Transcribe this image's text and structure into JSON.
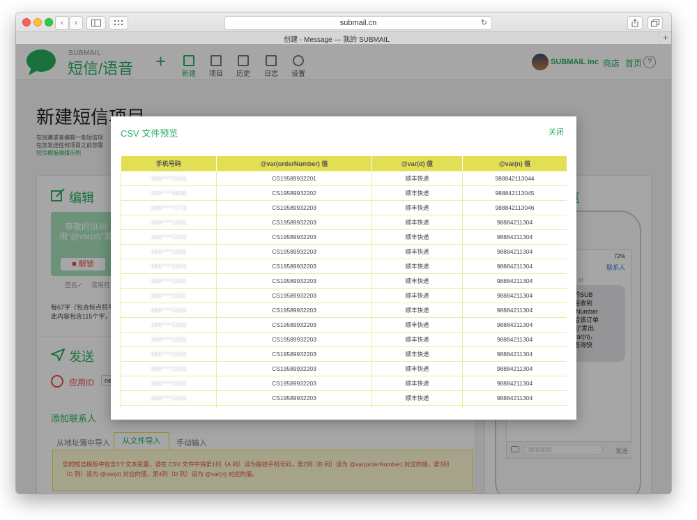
{
  "browser": {
    "url": "submail.cn",
    "tab_title": "创建 - Message — 我的 SUBMAIL",
    "tab_plus": "+",
    "reload_glyph": "↻",
    "back_glyph": "‹",
    "forward_glyph": "›"
  },
  "app": {
    "brand_small": "SUBMAIL",
    "brand_big": "短信/语音",
    "plus": "+",
    "nav": [
      {
        "label": "新建",
        "icon": "new-icon"
      },
      {
        "label": "项目",
        "icon": "project-icon"
      },
      {
        "label": "历史",
        "icon": "history-icon"
      },
      {
        "label": "日志",
        "icon": "log-icon"
      },
      {
        "label": "设置",
        "icon": "settings-icon"
      }
    ],
    "account_name": "SUBMAIL inc",
    "store_link": "商店",
    "home_link": "首页",
    "help": "?"
  },
  "page": {
    "title": "新建短信项目",
    "desc_line1": "在创建或者编辑一条短信项",
    "desc_line2": "在您发送任何项目之前您需",
    "desc_link": "短信模板编辑示例",
    "edit_heading": "编辑",
    "bubble_line1": "尊敬的SUB",
    "bubble_line2": "用\"@var(d)\"发",
    "unlock_button": "解锁",
    "signature_label": "签名✓",
    "common_label": "常用符",
    "count_line1": "每67字（包含标点符号",
    "count_line2": "此内容包含115个字，",
    "send_heading": "发送",
    "app_id_label": "应用ID",
    "app_id_value": "ne",
    "contacts_heading": "添加联系人",
    "tabs": [
      "从地址簿中导入",
      "从文件导入",
      "手动输入"
    ],
    "notice_line1": "您的短信模板中包含3个文本变量，请在 CSV 文件中将第1列（A 列）设为接收手机号码，第2列（B 列）设为 @var(orderNumber) 对应的值，第3列",
    "notice_line2": "（C 列）设为 @var(d) 对应的值，第4列（D 列）设为 @var(n) 对应的值。",
    "preview_heading": "览",
    "phone_status": "72%",
    "phone_contact": "联系人",
    "phone_time": "18",
    "phone_bubble": [
      "的SUB",
      "经收到",
      "rNumber",
      "给该订单",
      "d)\"发出",
      "var(n)，",
      "查询快"
    ],
    "phone_input_placeholder": "短信/彩信",
    "phone_send": "发送"
  },
  "modal": {
    "title": "CSV 文件预览",
    "close": "关闭",
    "headers": [
      "手机号码",
      "@var(orderNumber) 值",
      "@var(d) 值",
      "@var(n) 值"
    ],
    "rows": [
      [
        "186****1001",
        "CS19589932201",
        "顺丰快递",
        "988842113044"
      ],
      [
        "153****6906",
        "CS19589932202",
        "顺丰快递",
        "988842113045"
      ],
      [
        "186****7772",
        "CS19589932203",
        "顺丰快递",
        "988842113046"
      ],
      [
        "186****1001",
        "CS19589932203",
        "顺丰快递",
        "98884211304"
      ],
      [
        "186****1001",
        "CS19589932203",
        "顺丰快递",
        "98884211304"
      ],
      [
        "186****1001",
        "CS19589932203",
        "顺丰快递",
        "98884211304"
      ],
      [
        "186****1001",
        "CS19589932203",
        "顺丰快递",
        "98884211304"
      ],
      [
        "186****1001",
        "CS19589932203",
        "顺丰快递",
        "98884211304"
      ],
      [
        "186****1001",
        "CS19589932203",
        "顺丰快递",
        "98884211304"
      ],
      [
        "186****1001",
        "CS19589932203",
        "顺丰快递",
        "98884211304"
      ],
      [
        "186****1001",
        "CS19589932203",
        "顺丰快递",
        "98884211304"
      ],
      [
        "186****1001",
        "CS19589932203",
        "顺丰快递",
        "98884211304"
      ],
      [
        "186****1001",
        "CS19589932203",
        "顺丰快递",
        "98884211304"
      ],
      [
        "186****1001",
        "CS19589932203",
        "顺丰快递",
        "98884211304"
      ],
      [
        "186****1001",
        "CS19589932203",
        "顺丰快递",
        "98884211304"
      ],
      [
        "186****1001",
        "CS19589932203",
        "顺丰快递",
        "98884211304"
      ],
      [
        "186****1001",
        "",
        "",
        ""
      ]
    ]
  },
  "colors": {
    "brand_green": "#27ae60",
    "table_header": "#e2df55",
    "accent_red": "#e74c3c"
  }
}
